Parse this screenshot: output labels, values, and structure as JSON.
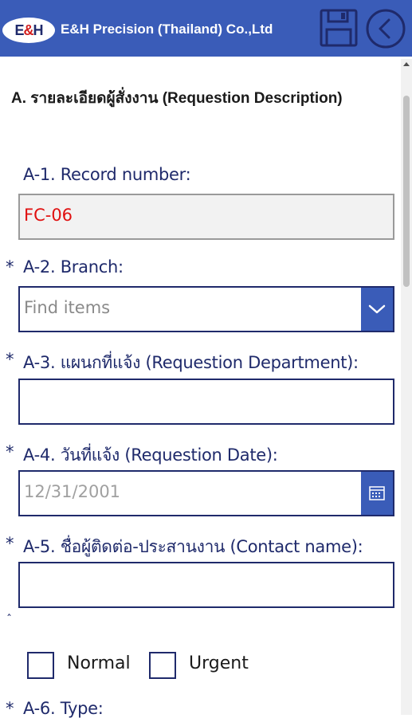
{
  "header": {
    "logo": "E&H",
    "company": "E&H Precision (Thailand) Co.,Ltd",
    "save_icon": "save-icon",
    "back_icon": "back-icon",
    "background_color": "#3a5cb8"
  },
  "section": {
    "title": "A. รายละเอียดผู้สั่งงาน (Requestion Description)"
  },
  "fields": {
    "record_number": {
      "label": "A-1. Record number:",
      "value": "FC-06",
      "value_color": "#e01010"
    },
    "branch": {
      "required": "*",
      "label": "A-2. Branch:",
      "placeholder": "Find items"
    },
    "department": {
      "required": "*",
      "label": "A-3. แผนกที่แจ้ง (Requestion Department):",
      "value": ""
    },
    "date": {
      "required": "*",
      "label": "A-4. วันที่แจ้ง (Requestion Date):",
      "placeholder": "12/31/2001"
    },
    "contact": {
      "required": "*",
      "label": "A-5. ชื่อผู้ติดต่อ-ประสานงาน (Contact name):",
      "value": ""
    },
    "caret": "ˆ",
    "priority": {
      "options": [
        "Normal",
        "Urgent"
      ]
    },
    "type": {
      "required": "*",
      "label": "A-6. Type:"
    }
  }
}
